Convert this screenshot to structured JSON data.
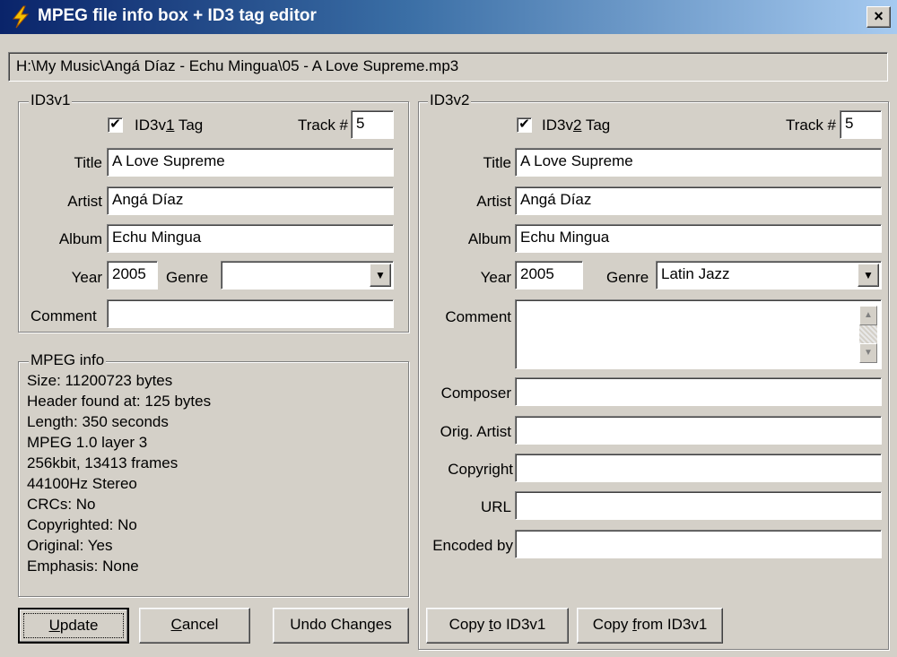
{
  "window": {
    "title": "MPEG file info box + ID3 tag editor",
    "close_glyph": "×",
    "app_icon": "lightning-bolt-icon"
  },
  "file_path": "H:\\My Music\\Angá Díaz - Echu Mingua\\05 - A Love Supreme.mp3",
  "id3v1": {
    "legend": "ID3v1",
    "tag_checkbox": {
      "label_pre": "ID3v",
      "label_ul": "1",
      "label_post": " Tag",
      "checked": true,
      "check_glyph": "✔"
    },
    "track_label": "Track #",
    "track": "5",
    "title_label": "Title",
    "title": "A Love Supreme",
    "artist_label": "Artist",
    "artist": "Angá Díaz",
    "album_label": "Album",
    "album": "Echu Mingua",
    "year_label": "Year",
    "year": "2005",
    "genre_label": "Genre",
    "genre": "",
    "comment_label": "Comment",
    "comment": ""
  },
  "mpeg_info": {
    "legend": "MPEG info",
    "lines": [
      "Size: 11200723 bytes",
      "Header found at: 125 bytes",
      "Length: 350 seconds",
      "MPEG 1.0 layer 3",
      "256kbit, 13413 frames",
      "44100Hz Stereo",
      "CRCs: No",
      "Copyrighted: No",
      "Original: Yes",
      "Emphasis: None"
    ]
  },
  "id3v2": {
    "legend": "ID3v2",
    "tag_checkbox": {
      "label_pre": "ID3v",
      "label_ul": "2",
      "label_post": " Tag",
      "checked": true,
      "check_glyph": "✔"
    },
    "track_label": "Track #",
    "track": "5",
    "title_label": "Title",
    "title": "A Love Supreme",
    "artist_label": "Artist",
    "artist": "Angá Díaz",
    "album_label": "Album",
    "album": "Echu Mingua",
    "year_label": "Year",
    "year": "2005",
    "genre_label": "Genre",
    "genre": "Latin Jazz",
    "comment_label": "Comment",
    "comment": "",
    "composer_label": "Composer",
    "composer": "",
    "orig_artist_label": "Orig. Artist",
    "orig_artist": "",
    "copyright_label": "Copyright",
    "copyright": "",
    "url_label": "URL",
    "url": "",
    "encoded_by_label": "Encoded by",
    "encoded_by": ""
  },
  "buttons": {
    "update": {
      "ul": "U",
      "rest": "pdate"
    },
    "cancel": {
      "ul": "C",
      "rest": "ancel"
    },
    "undo": "Undo Changes",
    "copy_to": {
      "pre": "Copy ",
      "ul": "t",
      "post": "o ID3v1"
    },
    "copy_from": {
      "pre": "Copy ",
      "ul": "f",
      "post": "rom ID3v1"
    }
  },
  "glyphs": {
    "dropdown": "▼",
    "scroll_up": "▲",
    "scroll_down": "▼"
  }
}
